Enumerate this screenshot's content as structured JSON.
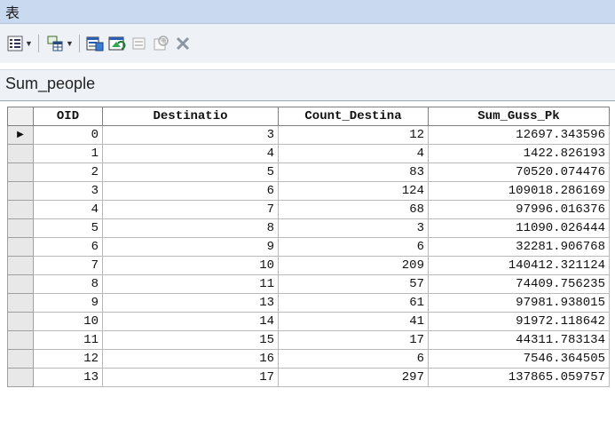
{
  "window": {
    "title": "表"
  },
  "toolbar": {
    "buttons": [
      {
        "name": "table-options-icon"
      },
      {
        "name": "related-tables-icon"
      },
      {
        "name": "select-by-attributes-icon"
      },
      {
        "name": "switch-selection-icon"
      },
      {
        "name": "clear-selection-icon"
      },
      {
        "name": "zoom-to-selected-icon"
      },
      {
        "name": "delete-selected-icon"
      }
    ]
  },
  "tab": {
    "name": "Sum_people"
  },
  "table": {
    "columns": [
      "OID",
      "Destinatio",
      "Count_Destina",
      "Sum_Guss_Pk"
    ],
    "rows": [
      [
        "0",
        "3",
        "12",
        "12697.343596"
      ],
      [
        "1",
        "4",
        "4",
        "1422.826193"
      ],
      [
        "2",
        "5",
        "83",
        "70520.074476"
      ],
      [
        "3",
        "6",
        "124",
        "109018.286169"
      ],
      [
        "4",
        "7",
        "68",
        "97996.016376"
      ],
      [
        "5",
        "8",
        "3",
        "11090.026444"
      ],
      [
        "6",
        "9",
        "6",
        "32281.906768"
      ],
      [
        "7",
        "10",
        "209",
        "140412.321124"
      ],
      [
        "8",
        "11",
        "57",
        "74409.756235"
      ],
      [
        "9",
        "13",
        "61",
        "97981.938015"
      ],
      [
        "10",
        "14",
        "41",
        "91972.118642"
      ],
      [
        "11",
        "15",
        "17",
        "44311.783134"
      ],
      [
        "12",
        "16",
        "6",
        "7546.364505"
      ],
      [
        "13",
        "17",
        "297",
        "137865.059757"
      ]
    ],
    "current_row_marker": "▶"
  }
}
